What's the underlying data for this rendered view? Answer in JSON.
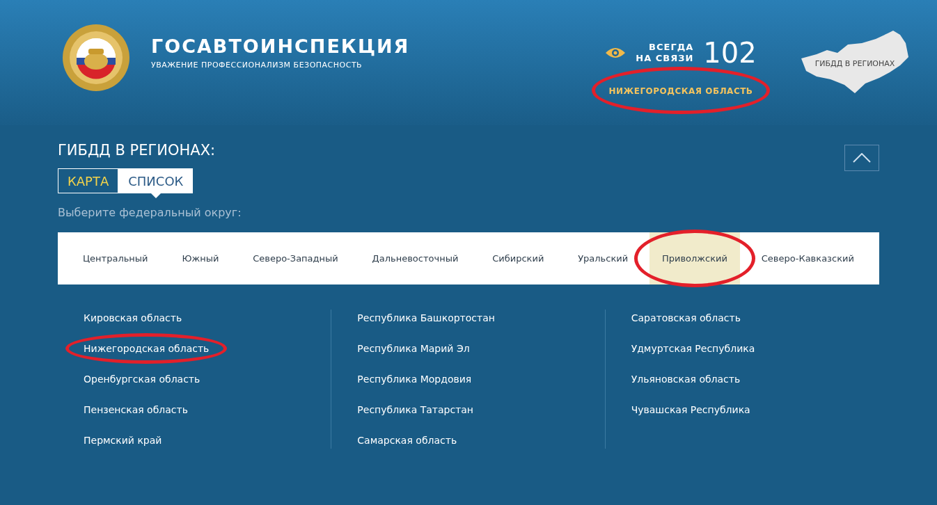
{
  "header": {
    "title": "ГОСАВТОИНСПЕКЦИЯ",
    "slogan": "УВАЖЕНИЕ ПРОФЕССИОНАЛИЗМ БЕЗОПАСНОСТЬ",
    "hotline_label": [
      "ВСЕГДА",
      "НА СВЯЗИ"
    ],
    "hotline_number": "102",
    "current_region": {
      "label": "НИЖЕГОРОДСКАЯ ОБЛАСТЬ",
      "circled": true
    },
    "map_link": "ГИБДД В РЕГИОНАХ"
  },
  "section": {
    "title": "ГИБДД В РЕГИОНАХ:",
    "view_tabs": [
      {
        "label": "КАРТА",
        "selected": false
      },
      {
        "label": "СПИСОК",
        "selected": true
      }
    ],
    "prompt": "Выберите федеральный округ:"
  },
  "districts": [
    {
      "label": "Центральный",
      "selected": false,
      "circled": false
    },
    {
      "label": "Южный",
      "selected": false,
      "circled": false
    },
    {
      "label": "Северо-Западный",
      "selected": false,
      "circled": false
    },
    {
      "label": "Дальневосточный",
      "selected": false,
      "circled": false
    },
    {
      "label": "Сибирский",
      "selected": false,
      "circled": false
    },
    {
      "label": "Уральский",
      "selected": false,
      "circled": false
    },
    {
      "label": "Приволжский",
      "selected": true,
      "circled": true
    },
    {
      "label": "Северо-Кавказский",
      "selected": false,
      "circled": false
    }
  ],
  "region_columns": [
    [
      {
        "label": "Кировская область",
        "circled": false
      },
      {
        "label": "Нижегородская область",
        "circled": true
      },
      {
        "label": "Оренбургская область",
        "circled": false
      },
      {
        "label": "Пензенская область",
        "circled": false
      },
      {
        "label": "Пермский край",
        "circled": false
      }
    ],
    [
      {
        "label": "Республика Башкортостан",
        "circled": false
      },
      {
        "label": "Республика Марий Эл",
        "circled": false
      },
      {
        "label": "Республика Мордовия",
        "circled": false
      },
      {
        "label": "Республика Татарстан",
        "circled": false
      },
      {
        "label": "Самарская область",
        "circled": false
      }
    ],
    [
      {
        "label": "Саратовская область",
        "circled": false
      },
      {
        "label": "Удмуртская Республика",
        "circled": false
      },
      {
        "label": "Ульяновская область",
        "circled": false
      },
      {
        "label": "Чувашская Республика",
        "circled": false
      }
    ]
  ]
}
